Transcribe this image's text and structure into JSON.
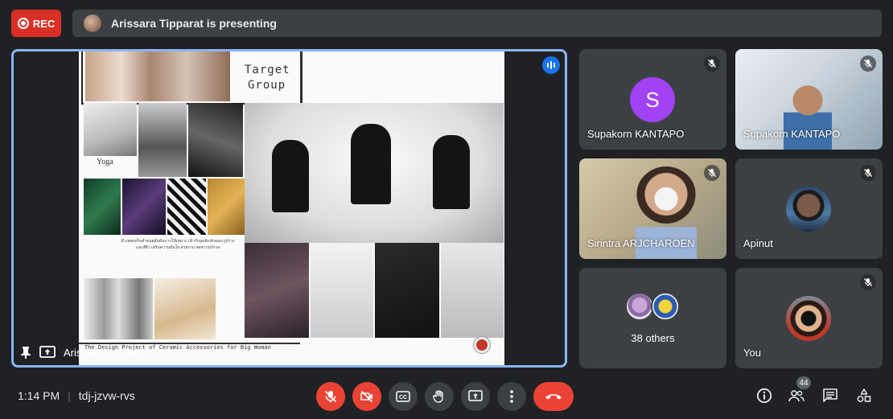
{
  "recording": {
    "label": "REC"
  },
  "presenter_bar": {
    "text": "Arissara Tipparat is presenting"
  },
  "main_tile": {
    "presenter_name": "Arissara Tipparat",
    "slide": {
      "target_group_line1": "Target",
      "target_group_line2": "Group",
      "yoga_label": "Yoga",
      "thai_caption": "สี แพตเทร็นคำต่อยสัมดันการใช้เหมาะ เข้ากับบุคลิกลักษณะรูปร่าง และสีผิว เสริมความมั่นใจ สวยงาม ลดความกังวล",
      "title": "The Design Project of Ceramic Accessories for Big Woman"
    }
  },
  "participants": [
    {
      "name": "Supakorn KANTAPO",
      "initial": "S",
      "muted": true,
      "avatar_color": "#a142f4"
    },
    {
      "name": "Supakorn KANTAPO",
      "muted": true
    },
    {
      "name": "Sirintra ARJCHAROEN",
      "muted": true
    },
    {
      "name": "Apinut",
      "muted": true
    },
    {
      "name": "38 others"
    },
    {
      "name": "You",
      "muted": true
    }
  ],
  "bottom_bar": {
    "time": "1:14 PM",
    "separator": "|",
    "meeting_code": "tdj-jzvw-rvs",
    "people_count": "44"
  },
  "colors": {
    "accent": "#8ab4f8",
    "danger": "#ea4335",
    "tile_bg": "#3c4043",
    "page_bg": "#202124"
  }
}
